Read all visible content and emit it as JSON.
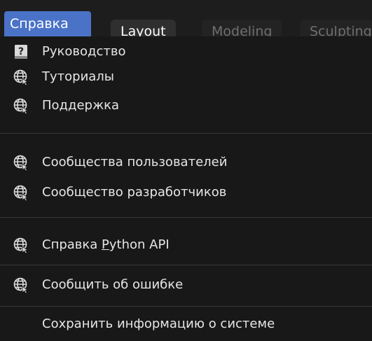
{
  "topbar": {
    "help_menu_label": "Справка",
    "tabs": [
      {
        "label": "Layout",
        "active": true
      },
      {
        "label": "Modeling",
        "active": false
      },
      {
        "label": "Sculpting",
        "active": false
      }
    ]
  },
  "menu": {
    "items": [
      {
        "label": "Руководство",
        "icon": "manual-icon"
      },
      {
        "label": "Туториалы",
        "icon": "web-icon"
      },
      {
        "label": "Поддержка",
        "icon": "web-icon"
      },
      {
        "label": "Сообщества пользователей",
        "icon": "web-icon"
      },
      {
        "label": "Сообщество разработчиков",
        "icon": "web-icon"
      },
      {
        "label_prefix": "Справка ",
        "label_underlined": "P",
        "label_suffix": "ython API",
        "icon": "web-icon"
      },
      {
        "label": "Сообщить об ошибке",
        "icon": "web-icon"
      },
      {
        "label": "Сохранить информацию о системе",
        "icon": ""
      }
    ]
  },
  "colors": {
    "accent": "#4a73c7",
    "menu_bg": "#181818",
    "separator": "#383838",
    "text": "#e6e6e6"
  }
}
